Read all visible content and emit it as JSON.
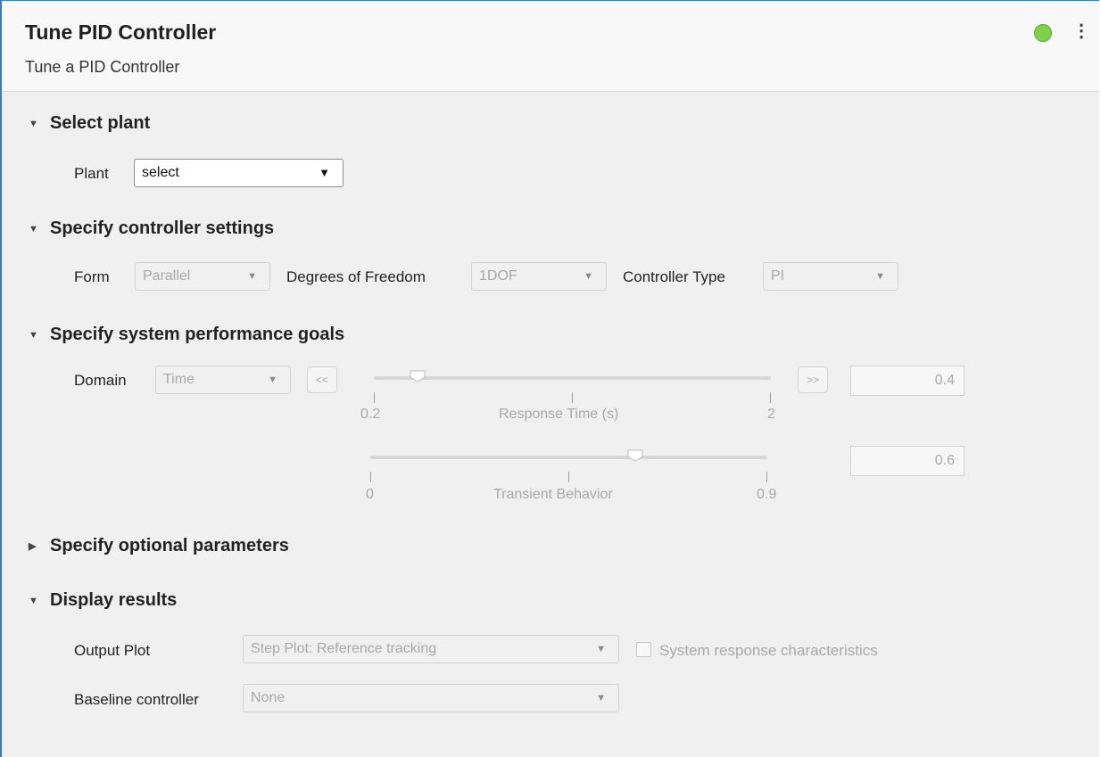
{
  "header": {
    "title": "Tune PID Controller",
    "subtitle": "Tune a PID Controller",
    "status_color": "#7fd04b",
    "menu_glyph": "⋮"
  },
  "sections": {
    "select_plant": {
      "title": "Select plant",
      "plant_label": "Plant",
      "plant_value": "select"
    },
    "controller_settings": {
      "title": "Specify controller settings",
      "form_label": "Form",
      "form_value": "Parallel",
      "dof_label": "Degrees of Freedom",
      "dof_value": "1DOF",
      "type_label": "Controller Type",
      "type_value": "PI"
    },
    "performance_goals": {
      "title": "Specify system performance goals",
      "domain_label": "Domain",
      "domain_value": "Time",
      "decrease_label": "<<",
      "increase_label": ">>",
      "response_time": {
        "label": "Response Time (s)",
        "min_label": "0.2",
        "max_label": "2",
        "value": "0.4",
        "fraction": 0.11
      },
      "transient": {
        "label": "Transient Behavior",
        "min_label": "0",
        "max_label": "0.9",
        "value": "0.6",
        "fraction": 0.667
      }
    },
    "optional_parameters": {
      "title": "Specify optional parameters"
    },
    "display_results": {
      "title": "Display results",
      "output_plot_label": "Output Plot",
      "output_plot_value": "Step Plot: Reference tracking",
      "checkbox_label": "System response characteristics",
      "checkbox_checked": false,
      "baseline_label": "Baseline controller",
      "baseline_value": "None"
    }
  }
}
